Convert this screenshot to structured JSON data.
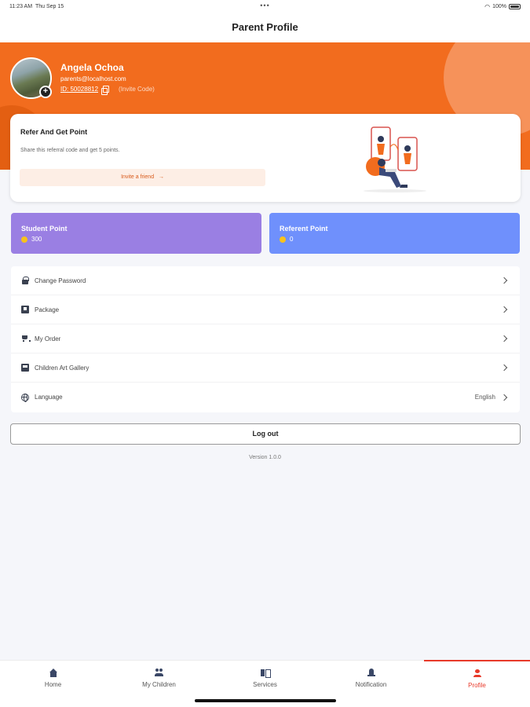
{
  "status_bar": {
    "time": "11:23 AM",
    "date": "Thu Sep 15",
    "dots": "•••",
    "battery": "100%"
  },
  "header": {
    "title": "Parent Profile"
  },
  "profile": {
    "name": "Angela Ochoa",
    "email": "parents@localhost.com",
    "id": "ID: 50028812",
    "invite_code_label": "(Invite Code)"
  },
  "refer": {
    "title": "Refer And Get Point",
    "description": "Share this referral code and get 5 points.",
    "invite_button": "Invite a friend",
    "invite_arrow": "→"
  },
  "points": {
    "student": {
      "title": "Student Point",
      "value": "300"
    },
    "referent": {
      "title": "Referent Point",
      "value": "0"
    }
  },
  "menu": {
    "items": [
      {
        "label": "Change Password",
        "icon": "lock-icon"
      },
      {
        "label": "Package",
        "icon": "package-icon"
      },
      {
        "label": "My Order",
        "icon": "cart-icon"
      },
      {
        "label": "Children Art Gallery",
        "icon": "gallery-icon"
      },
      {
        "label": "Language",
        "icon": "globe-icon",
        "value": "English"
      }
    ]
  },
  "logout": {
    "label": "Log out"
  },
  "version": "Version 1.0.0",
  "tabs": [
    {
      "label": "Home",
      "icon": "home-icon"
    },
    {
      "label": "My Children",
      "icon": "children-icon"
    },
    {
      "label": "Services",
      "icon": "services-icon"
    },
    {
      "label": "Notification",
      "icon": "bell-icon"
    },
    {
      "label": "Profile",
      "icon": "profile-icon",
      "active": true
    }
  ],
  "colors": {
    "brand_orange": "#f26c1e",
    "student_purple": "#9a7fe3",
    "referent_blue": "#6f90fc",
    "active_tab_red": "#e83a2a",
    "coin_yellow": "#f8c21c"
  }
}
